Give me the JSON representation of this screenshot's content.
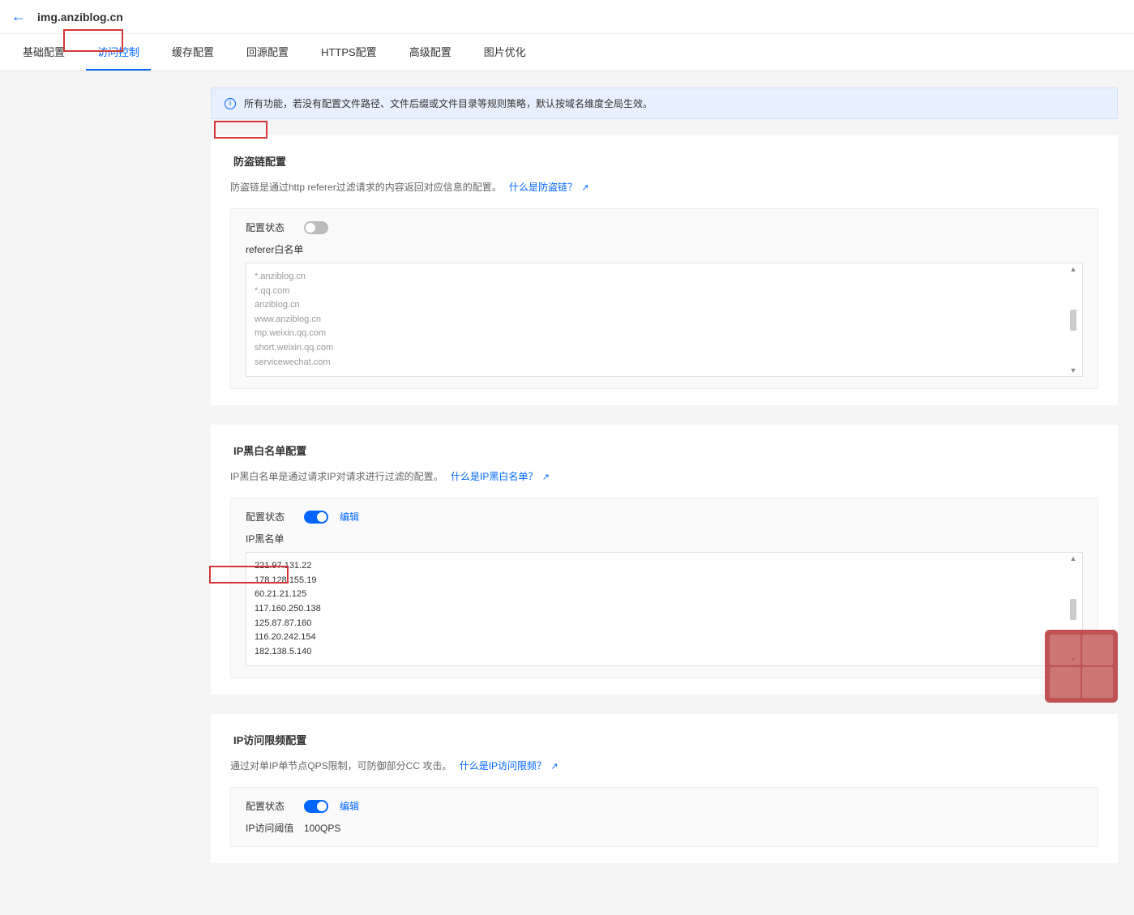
{
  "header": {
    "domain": "img.anziblog.cn"
  },
  "tabs": [
    "基础配置",
    "访问控制",
    "缓存配置",
    "回源配置",
    "HTTPS配置",
    "高级配置",
    "图片优化"
  ],
  "activeTab": 1,
  "notice": "所有功能，若没有配置文件路径、文件后缀或文件目录等规则策略，默认按域名维度全局生效。",
  "hotlink": {
    "title": "防盗链配置",
    "desc": "防盗链是通过http referer过滤请求的内容返回对应信息的配置。",
    "link": "什么是防盗链？",
    "status_label": "配置状态",
    "sub_label": "referer白名单",
    "enabled": false,
    "list": [
      "*.anziblog.cn",
      "*.qq.com",
      "anziblog.cn",
      "www.anziblog.cn",
      "mp.weixin.qq.com",
      "short.weixin.qq.com",
      "servicewechat.com"
    ]
  },
  "ipbw": {
    "title": "IP黑白名单配置",
    "desc": "IP黑白名单是通过请求IP对请求进行过滤的配置。",
    "link": "什么是IP黑白名单？",
    "status_label": "配置状态",
    "edit": "编辑",
    "sub_label": "IP黑名单",
    "enabled": true,
    "list": [
      "221.97.131.22",
      "178.128.155.19",
      "60.21.21.125",
      "117.160.250.138",
      "125.87.87.160",
      "116.20.242.154",
      "182.138.5.140"
    ]
  },
  "ratelimit": {
    "title": "IP访问限频配置",
    "desc": "通过对单IP单节点QPS限制，可防御部分CC 攻击。",
    "link": "什么是IP访问限频？",
    "status_label": "配置状态",
    "edit": "编辑",
    "threshold_label": "IP访问阈值",
    "threshold_value": "100QPS",
    "enabled": true
  }
}
